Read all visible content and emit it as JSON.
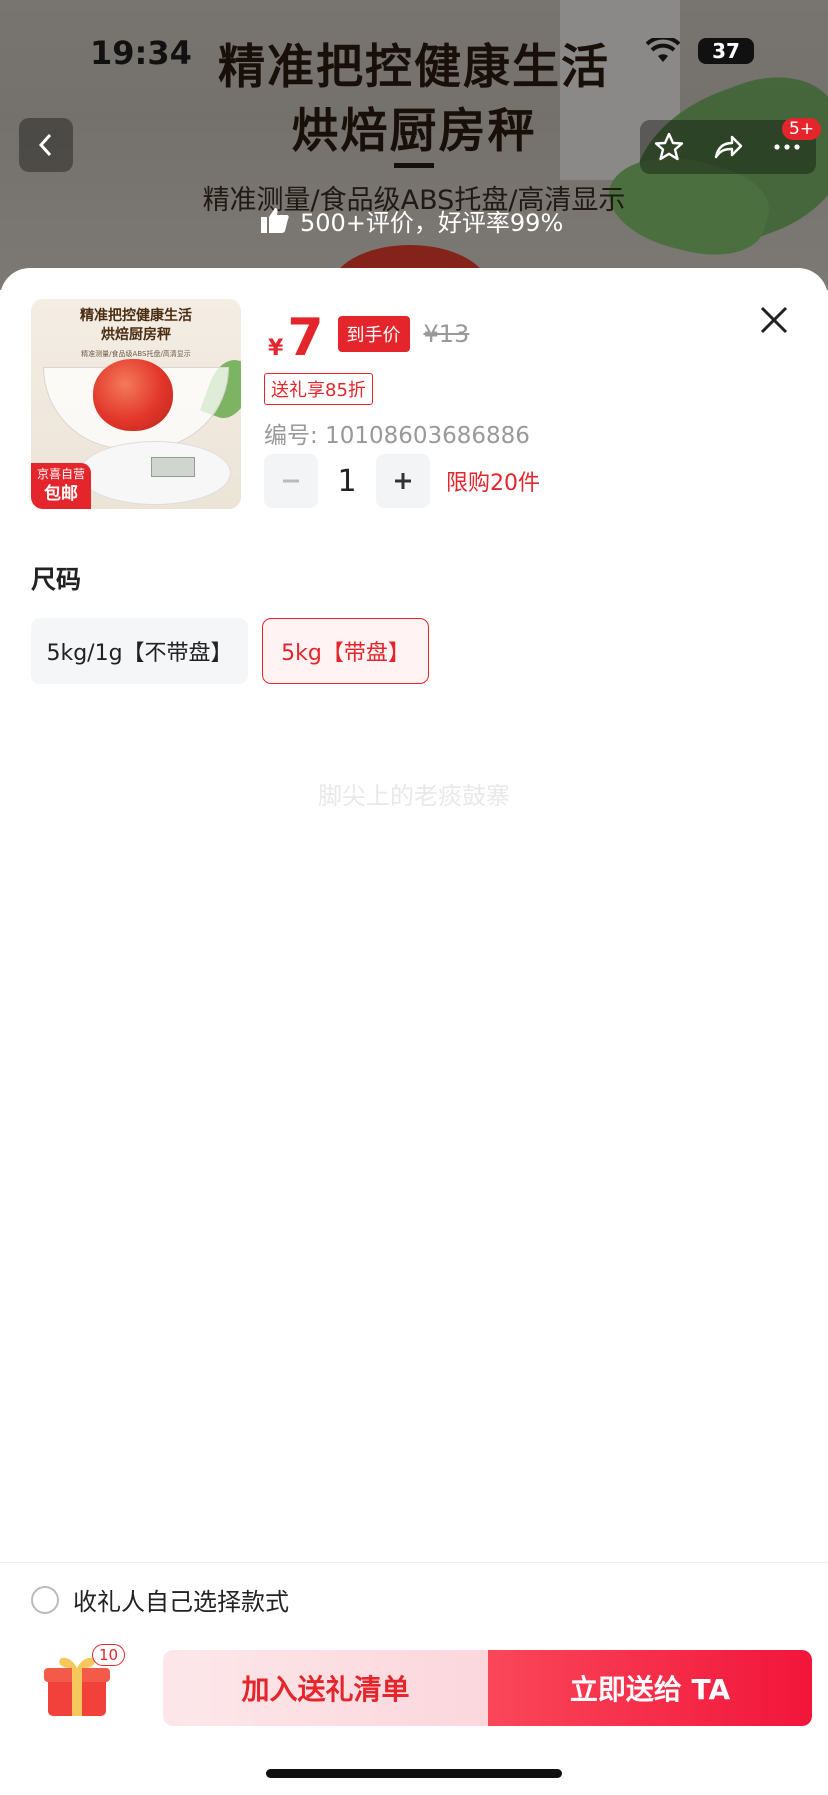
{
  "status_bar": {
    "time": "19:34",
    "battery": "37"
  },
  "hero": {
    "title_line1": "精准把控健康生活",
    "title_line2": "烘焙厨房秤",
    "subtitle": "精准测量/食品级ABS托盘/高清显示",
    "review_text": "500+评价，好评率99%"
  },
  "nav": {
    "badge": "5+",
    "icons": [
      "back-icon",
      "star-icon",
      "share-icon",
      "more-icon"
    ]
  },
  "product": {
    "thumb_title": "精准把控健康生活 烘焙厨房秤",
    "thumb_sub": "精准测量/食品级ABS托盘/高清显示",
    "tag_line1": "京喜自营",
    "tag_line2": "包邮",
    "currency": "¥",
    "price": "7",
    "price_tag": "到手价",
    "old_price": "¥13",
    "gift_discount": "送礼享85折",
    "sku_label": "编号:",
    "sku_value": "10108603686886",
    "quantity": "1",
    "limit_text": "限购20件"
  },
  "size": {
    "label": "尺码",
    "options": [
      {
        "label": "5kg/1g【不带盘】",
        "selected": false
      },
      {
        "label": "5kg【带盘】",
        "selected": true
      }
    ]
  },
  "watermark": "脚尖上的老痰鼓寨",
  "footer": {
    "self_choose_label": "收礼人自己选择款式",
    "gift_count": "10",
    "add_button": "加入送礼清单",
    "send_button": "立即送给 TA"
  },
  "colors": {
    "accent": "#e4252c",
    "send_gradient_start": "#fa4759",
    "send_gradient_end": "#f2153a"
  }
}
